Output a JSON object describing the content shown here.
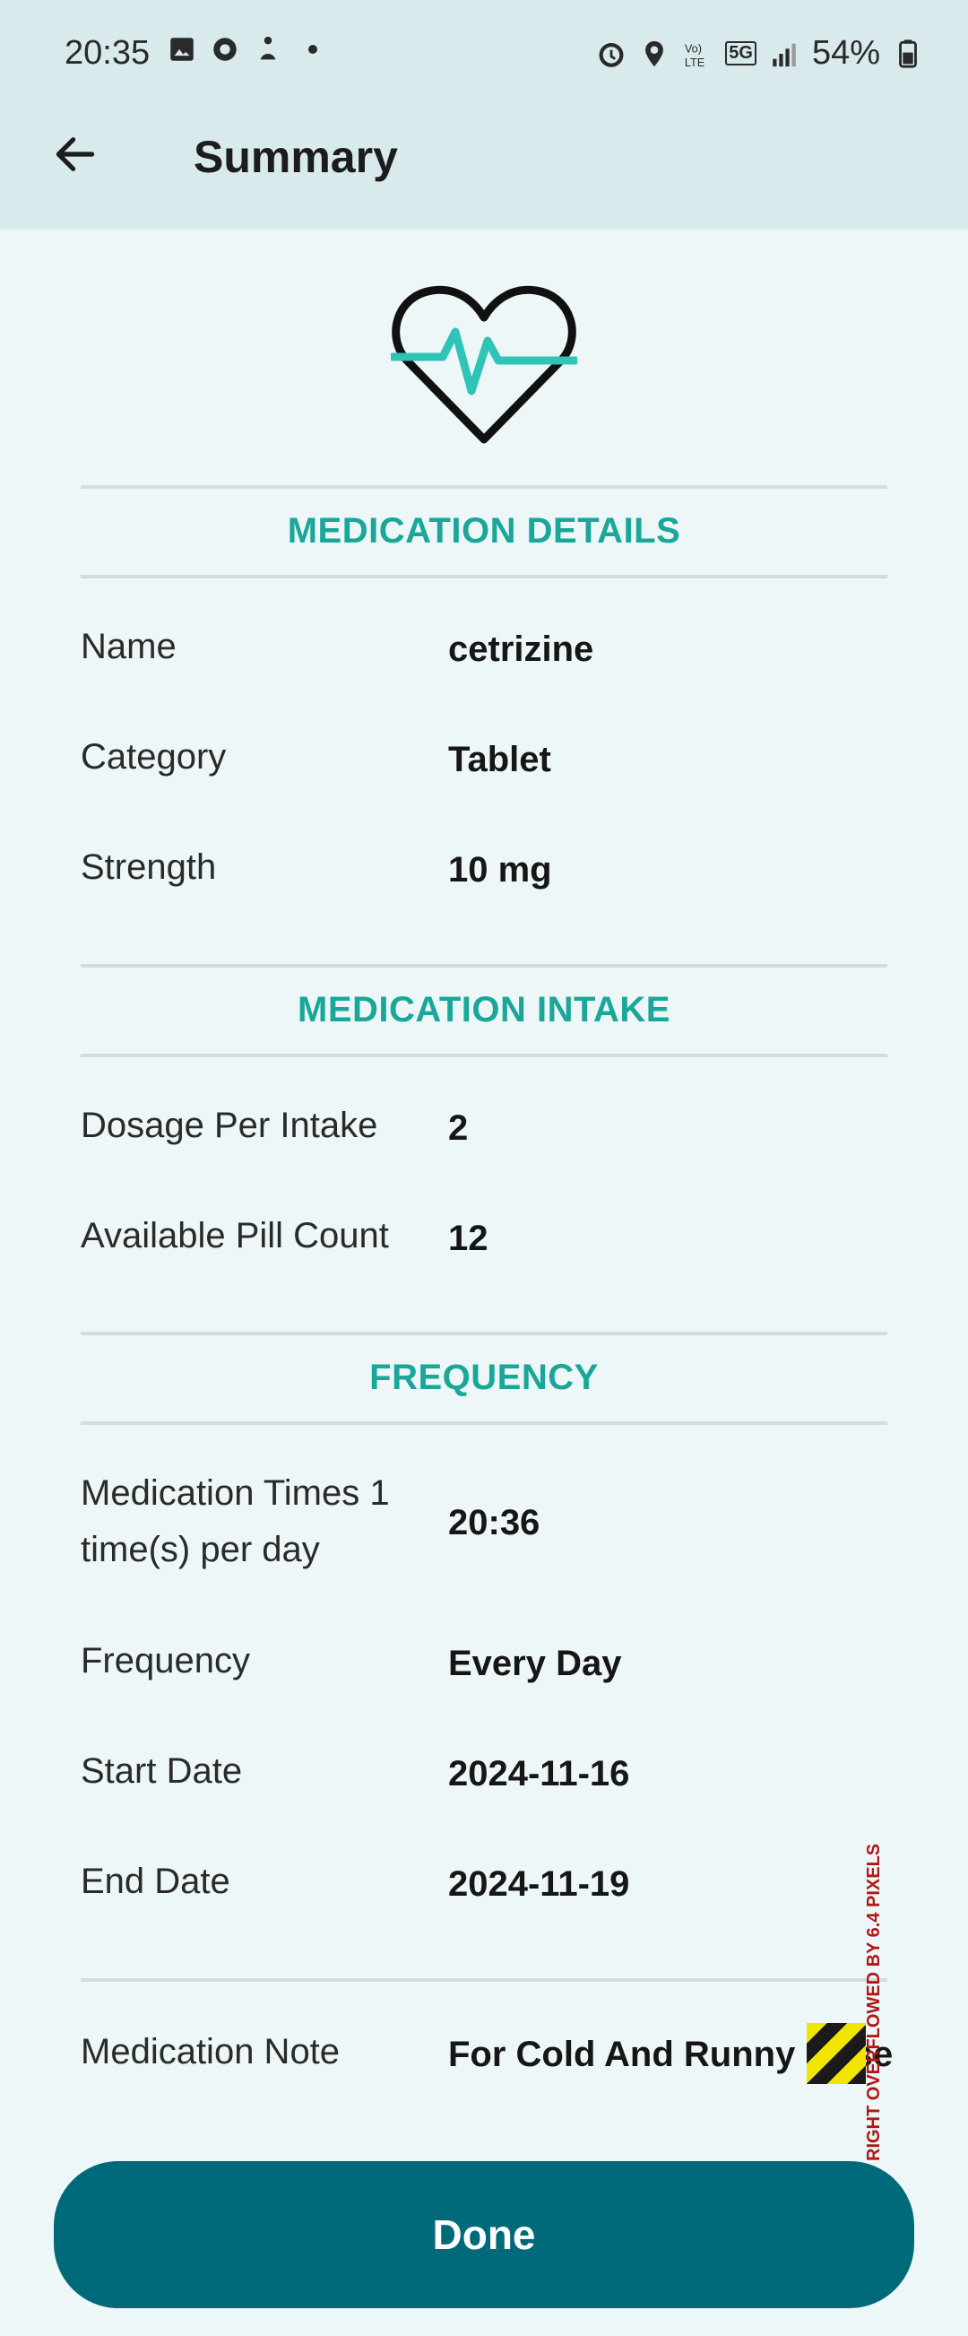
{
  "status_bar": {
    "time": "20:35",
    "battery": "54%",
    "network": "5G"
  },
  "header": {
    "title": "Summary"
  },
  "sections": {
    "details": {
      "title": "MEDICATION DETAILS",
      "rows": [
        {
          "label": "Name",
          "value": "cetrizine"
        },
        {
          "label": "Category",
          "value": "Tablet"
        },
        {
          "label": "Strength",
          "value": "10 mg"
        }
      ]
    },
    "intake": {
      "title": "MEDICATION INTAKE",
      "rows": [
        {
          "label": "Dosage Per Intake",
          "value": "2"
        },
        {
          "label": "Available Pill Count",
          "value": "12"
        }
      ]
    },
    "frequency": {
      "title": "FREQUENCY",
      "times_label_line1": "Medication Times 1",
      "times_label_line2": "time(s) per day",
      "times_value": "20:36",
      "rows": [
        {
          "label": "Frequency",
          "value": "Every Day"
        },
        {
          "label": "Start Date",
          "value": "2024-11-16"
        },
        {
          "label": "End Date",
          "value": "2024-11-19"
        }
      ]
    },
    "note": {
      "label": "Medication Note",
      "value": "For Cold And Runny Nose"
    }
  },
  "overflow_warning": "RIGHT OVERFLOWED BY 6.4 PIXELS",
  "actions": {
    "done_label": "Done"
  },
  "colors": {
    "accent": "#1aa79a",
    "button": "#00697a",
    "appbar": "#d8eaec",
    "background": "#eef7f8"
  }
}
